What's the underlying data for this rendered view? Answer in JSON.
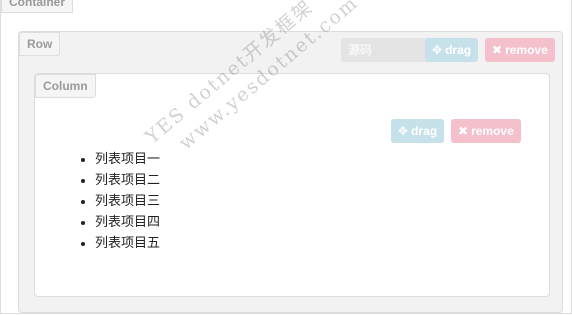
{
  "container": {
    "label": "Container"
  },
  "row": {
    "label": "Row",
    "view_code_label": "源码",
    "drag_label": "drag",
    "remove_label": "remove"
  },
  "column": {
    "label": "Column",
    "drag_label": "drag",
    "remove_label": "remove",
    "items": [
      "列表项目一",
      "列表项目二",
      "列表项目三",
      "列表项目四",
      "列表项目五"
    ]
  },
  "watermark": {
    "line1": "YES dotnet开发框架",
    "line2": "www.yesdotnet.com"
  },
  "icons": {
    "drag": "move-icon",
    "remove": "close-icon"
  },
  "colors": {
    "drag": "#c6e1ea",
    "remove": "#f4c0cc",
    "code": "#e4e4e4"
  }
}
